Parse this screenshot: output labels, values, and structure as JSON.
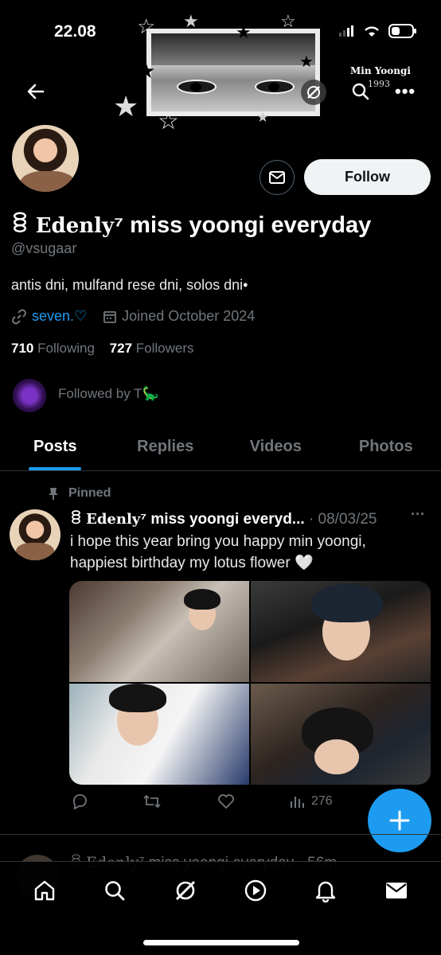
{
  "status": {
    "time": "22.08"
  },
  "banner": {
    "name": "Min Yoongi",
    "year": "1993"
  },
  "profile": {
    "display_name_prefix": "ꊞ",
    "display_name_serif": "Edenly",
    "display_name_sup": "⁷",
    "display_name_rest": " miss yoongi everyday",
    "handle": "@vsugaar",
    "bio": "antis dni, mulfand rese dni, solos dni•",
    "link": "seven.♡",
    "joined": "Joined October 2024",
    "following_count": "710",
    "following_label": "Following",
    "followers_count": "727",
    "followers_label": "Followers",
    "followed_by": "Followed by T🦕",
    "follow_label": "Follow"
  },
  "tabs": [
    {
      "label": "Posts",
      "active": true
    },
    {
      "label": "Replies",
      "active": false
    },
    {
      "label": "Videos",
      "active": false
    },
    {
      "label": "Photos",
      "active": false
    }
  ],
  "post": {
    "pinned_label": "Pinned",
    "name_prefix": "ꊞ",
    "name_serif": "Edenly",
    "name_sup": "⁷",
    "name_rest": " miss yoongi everyd...",
    "date": "· 08/03/25",
    "text": "i hope this year bring you happy min yoongi, happiest birthday my lotus flower 🤍",
    "views": "276"
  },
  "next_post": {
    "name_prefix": "ꊞ",
    "name_serif": "Edenly",
    "name_sup": "⁷",
    "name_rest": " miss yoongi everyday · 56m"
  },
  "icons": [
    "back-arrow-icon",
    "grok-icon",
    "search-icon",
    "more-icon",
    "mail-icon",
    "link-icon",
    "calendar-icon",
    "pin-icon",
    "reply-icon",
    "retweet-icon",
    "like-icon",
    "views-icon",
    "plus-icon",
    "home-icon",
    "nav-search-icon",
    "nav-grok-icon",
    "play-icon",
    "bell-icon",
    "nav-mail-icon"
  ],
  "colors": {
    "accent": "#1d9bf0",
    "background": "#000000",
    "muted": "#71767b"
  }
}
